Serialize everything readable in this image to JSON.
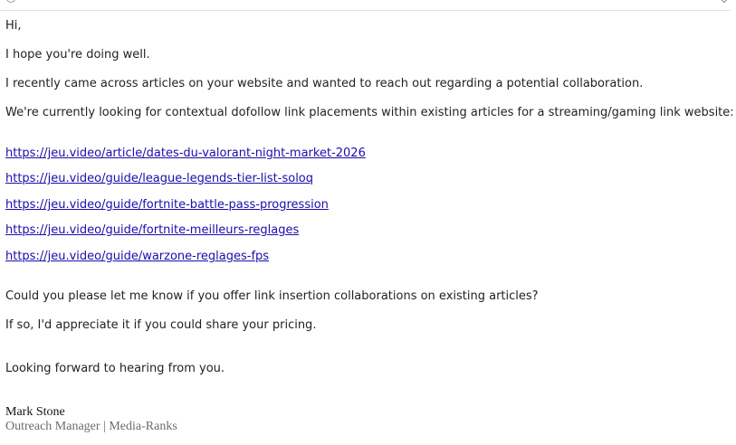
{
  "email": {
    "greeting": "Hi,",
    "opening": "I hope you're doing well.",
    "intro": "I recently came across articles on your website and wanted to reach out regarding a potential collaboration.",
    "request": "We're currently looking for contextual dofollow link placements within existing articles for a streaming/gaming link website:",
    "links": [
      "https://jeu.video/article/dates-du-valorant-night-market-2026",
      "https://jeu.video/guide/league-legends-tier-list-soloq",
      "https://jeu.video/guide/fortnite-battle-pass-progression",
      "https://jeu.video/guide/fortnite-meilleurs-reglages",
      "https://jeu.video/guide/warzone-reglages-fps"
    ],
    "question": "Could you please let me know if you offer link insertion collaborations on existing articles?",
    "pricing": "If so, I'd appreciate it if you could share your pricing.",
    "closing": "Looking forward to hearing from you.",
    "signature": {
      "name": "Mark Stone",
      "title": "Outreach Manager | Media-Ranks"
    }
  },
  "colors": {
    "text": "#222222",
    "link": "#1a0dab",
    "signature_title": "#6b6b6b"
  },
  "icons": {
    "top_left": "circle-icon",
    "top_right": "chevron-down-icon"
  }
}
